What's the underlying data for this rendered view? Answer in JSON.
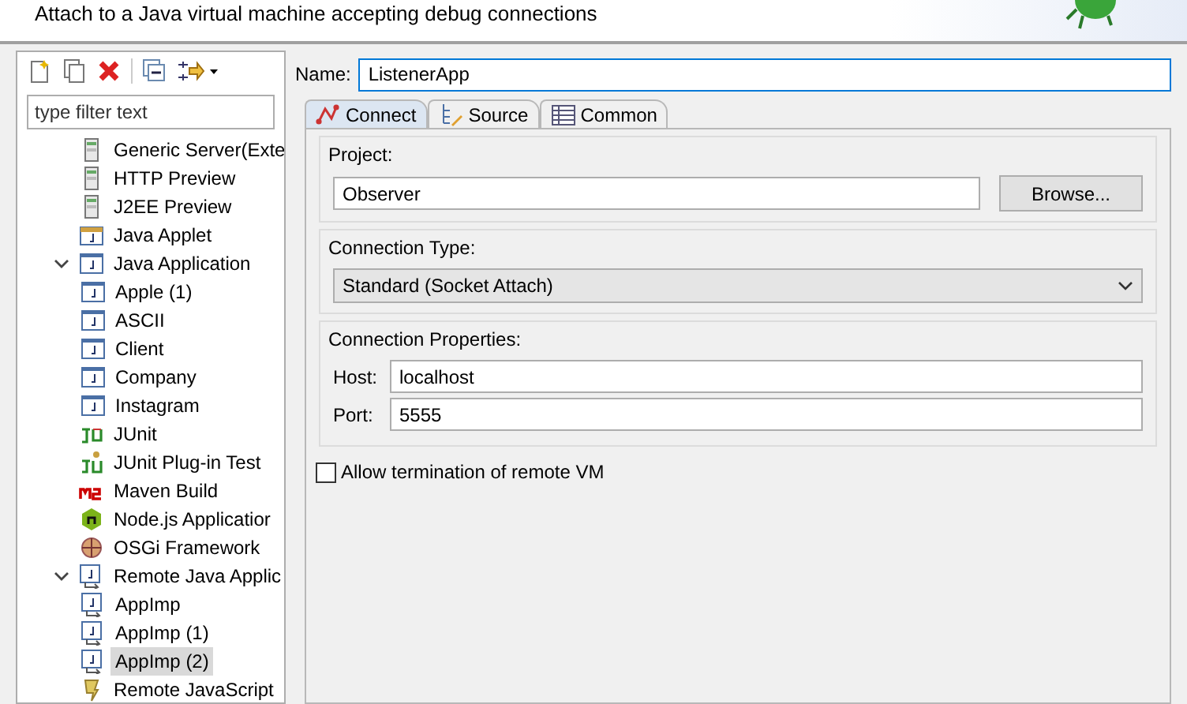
{
  "header": {
    "description": "Attach to a Java virtual machine accepting debug connections"
  },
  "filter": {
    "placeholder": "type filter text"
  },
  "tree": [
    {
      "label": "Generic Server(Exte",
      "kind": "server",
      "selected": false
    },
    {
      "label": "HTTP Preview",
      "kind": "server",
      "selected": false
    },
    {
      "label": "J2EE Preview",
      "kind": "server",
      "selected": false
    },
    {
      "label": "Java Applet",
      "kind": "applet",
      "selected": false
    },
    {
      "label": "Java Application",
      "kind": "java",
      "selected": false,
      "expanded": true,
      "children": [
        {
          "label": "Apple (1)",
          "kind": "java",
          "selected": false
        },
        {
          "label": "ASCII",
          "kind": "java",
          "selected": false
        },
        {
          "label": "Client",
          "kind": "java",
          "selected": false
        },
        {
          "label": "Company",
          "kind": "java",
          "selected": false
        },
        {
          "label": "Instagram",
          "kind": "java",
          "selected": false
        }
      ]
    },
    {
      "label": "JUnit",
      "kind": "junit",
      "selected": false
    },
    {
      "label": "JUnit Plug-in Test",
      "kind": "junitplugin",
      "selected": false
    },
    {
      "label": "Maven Build",
      "kind": "maven",
      "selected": false
    },
    {
      "label": "Node.js Applicatior",
      "kind": "node",
      "selected": false
    },
    {
      "label": "OSGi Framework",
      "kind": "osgi",
      "selected": false
    },
    {
      "label": "Remote Java Applic",
      "kind": "remote",
      "selected": false,
      "expanded": true,
      "children": [
        {
          "label": "AppImp",
          "kind": "remote",
          "selected": false
        },
        {
          "label": "AppImp (1)",
          "kind": "remote",
          "selected": false
        },
        {
          "label": "AppImp (2)",
          "kind": "remote",
          "selected": true
        }
      ]
    },
    {
      "label": "Remote JavaScript",
      "kind": "remotejs",
      "selected": false
    }
  ],
  "name": {
    "label": "Name:",
    "value": "ListenerApp"
  },
  "tabs": [
    {
      "label": "Connect",
      "kind": "connect",
      "selected": true
    },
    {
      "label": "Source",
      "kind": "source",
      "selected": false
    },
    {
      "label": "Common",
      "kind": "common",
      "selected": false
    }
  ],
  "project": {
    "label": "Project:",
    "value": "Observer",
    "button": "Browse..."
  },
  "connection_type": {
    "label": "Connection Type:",
    "value": "Standard (Socket Attach)"
  },
  "connection_properties": {
    "label": "Connection Properties:",
    "fields": [
      {
        "label": "Host:",
        "value": "localhost"
      },
      {
        "label": "Port:",
        "value": "5555"
      }
    ]
  },
  "allow_termination": {
    "label": "Allow termination of remote VM",
    "checked": false
  }
}
